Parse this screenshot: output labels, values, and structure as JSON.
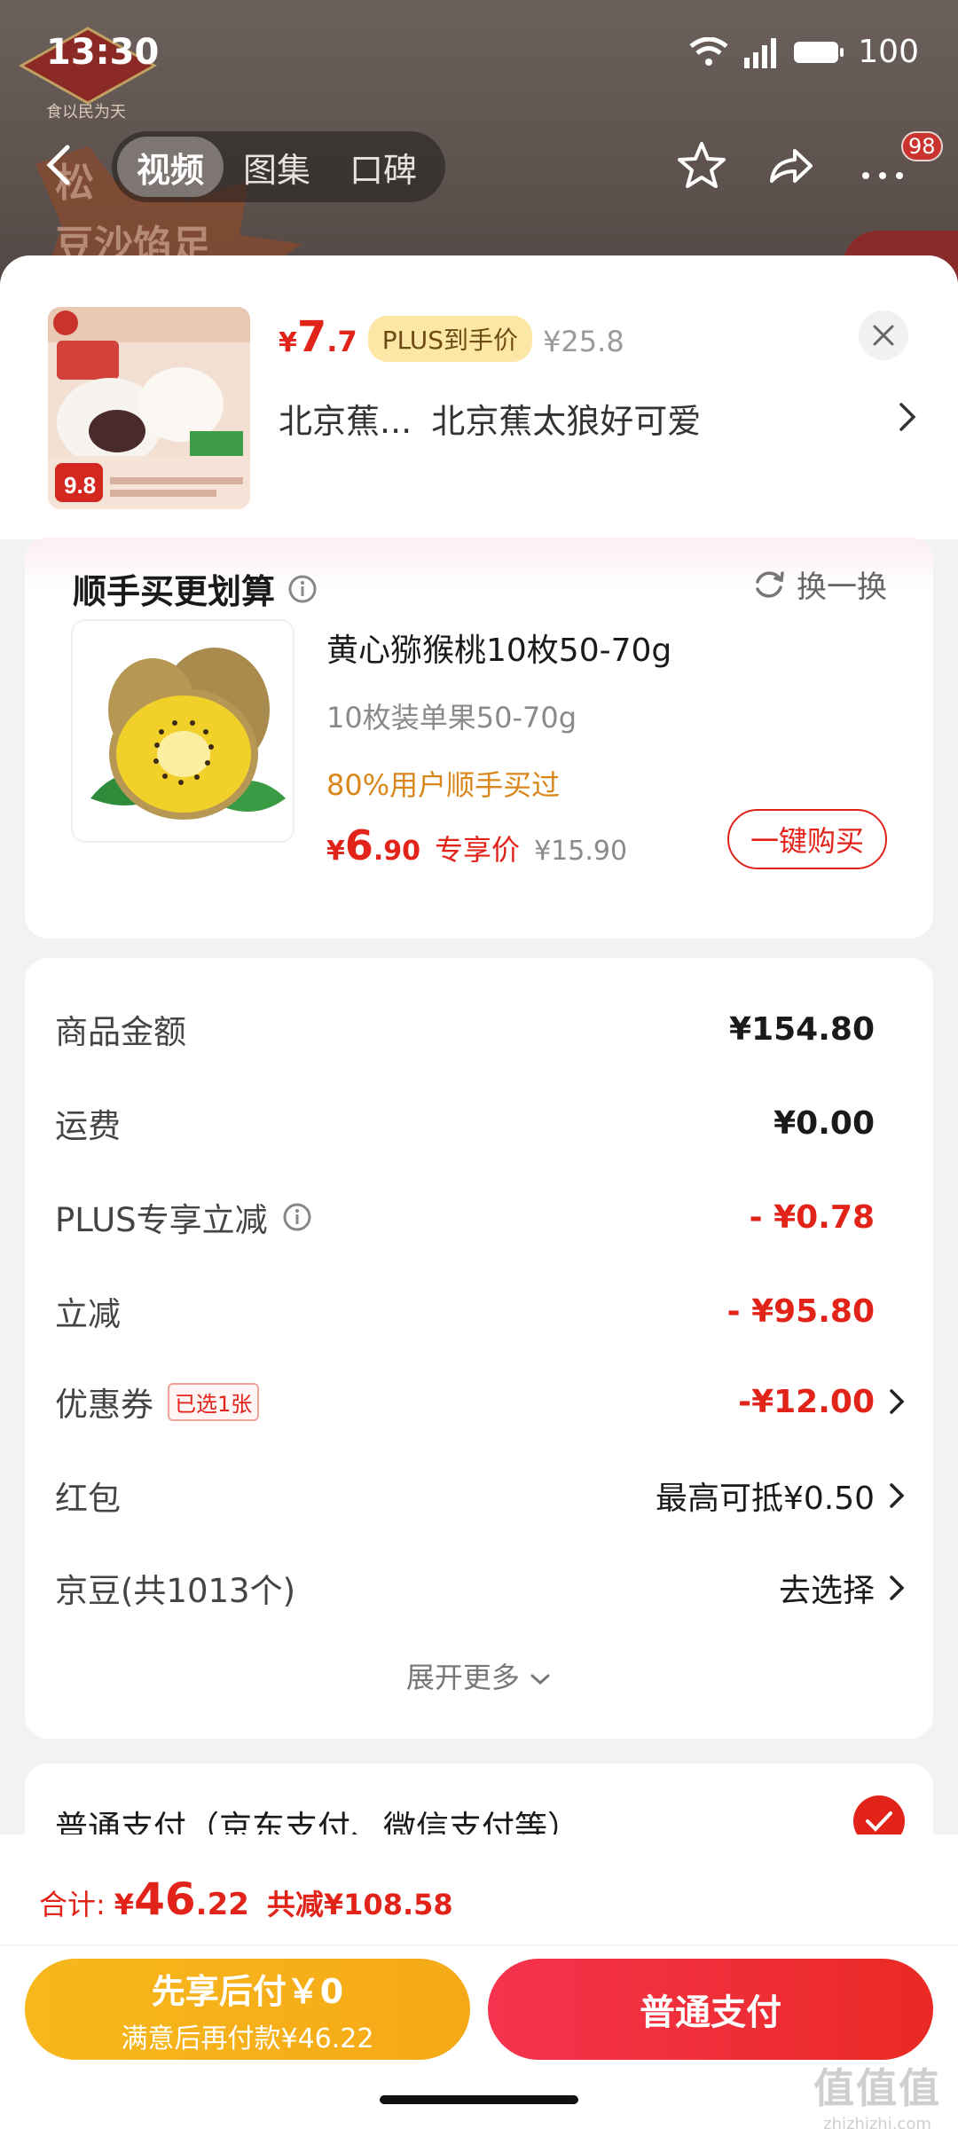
{
  "status_bar": {
    "time": "13:30",
    "battery": "100"
  },
  "background": {
    "logo_text": "食以民为天",
    "promo_line1": "松",
    "promo_line2": "豆沙馅足"
  },
  "nav": {
    "tabs": [
      {
        "label": "视频"
      },
      {
        "label": "图集"
      },
      {
        "label": "口碑"
      }
    ],
    "cart_badge": "98"
  },
  "product": {
    "price_symbol": "¥",
    "price_int": "7",
    "price_dec": ".7",
    "plus_tag": "PLUS到手价",
    "original_price": "¥25.8",
    "variant_short": "北京蕉...",
    "variant_full": "北京蕉太狼好可爱",
    "thumb_price": "9.8"
  },
  "addon": {
    "title": "顺手买更划算",
    "refresh_label": "换一换",
    "name": "黄心猕猴桃10枚50-70g",
    "spec": "10枚装单果50-70g",
    "social": "80%用户顺手买过",
    "price_symbol": "¥",
    "price_int": "6",
    "price_dec": ".90",
    "price_tag": "专享价",
    "original_price": "¥15.90",
    "buy_label": "一键购买"
  },
  "fees": {
    "rows": [
      {
        "label": "商品金额",
        "value": "¥154.80"
      },
      {
        "label": "运费",
        "value": "¥0.00"
      },
      {
        "label": "PLUS专享立减",
        "value": "- ¥0.78"
      },
      {
        "label": "立减",
        "value": "- ¥95.80"
      },
      {
        "label": "优惠券",
        "tag": "已选1张",
        "value": "-¥12.00"
      },
      {
        "label": "红包",
        "value": "最高可抵¥0.50"
      },
      {
        "label": "京豆(共1013个)",
        "value": "去选择"
      }
    ],
    "expand_label": "展开更多"
  },
  "payment": {
    "method_label": "普通支付（京东支付、微信支付等）"
  },
  "bottom": {
    "total_label": "合计:",
    "total_symbol": "¥",
    "total_int": "46",
    "total_dec": ".22",
    "total_saved": "共减¥108.58",
    "later_main": "先享后付￥0",
    "later_sub": "满意后再付款¥46.22",
    "pay_label": "普通支付"
  },
  "watermark": {
    "big": "值值值",
    "small": "zhizhizhi.com"
  },
  "colors": {
    "accent_red": "#e2231a",
    "plus_gold": "#fde7a6",
    "later_yellow": "#f7b81c",
    "social_orange": "#d9861b"
  }
}
